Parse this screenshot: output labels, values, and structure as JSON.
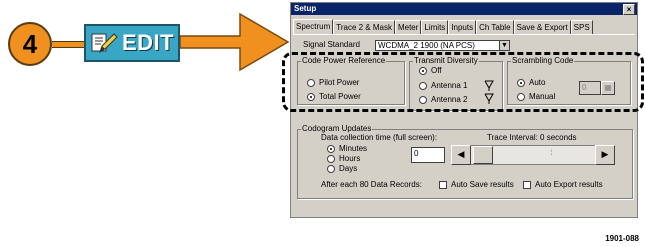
{
  "callout": {
    "step_number": "4",
    "button_label": "EDIT"
  },
  "dialog": {
    "title": "Setup",
    "close_glyph": "×",
    "tabs": [
      "Spectrum",
      "Trace 2 & Mask",
      "Meter",
      "Limits",
      "Inputs",
      "Ch Table",
      "Save & Export",
      "SPS"
    ],
    "signal_standard": {
      "label": "Signal Standard",
      "value": "WCDMA_2 1900 (NA PCS)"
    },
    "code_power_reference": {
      "title": "Code Power Reference",
      "options": [
        "Pilot Power",
        "Total Power"
      ],
      "selected": "Total Power"
    },
    "transmit_diversity": {
      "title": "Transmit Diversity",
      "options": [
        "Off",
        "Antenna 1",
        "Antenna 2"
      ],
      "selected": "Off"
    },
    "scrambling_code": {
      "title": "Scrambling Code",
      "options": [
        "Auto",
        "Manual"
      ],
      "selected": "Auto",
      "value": "0"
    },
    "codogram_updates": {
      "title": "Codogram Updates",
      "collection_label": "Data collection time (full screen):",
      "trace_interval": "Trace Interval: 0 seconds",
      "units": [
        "Minutes",
        "Hours",
        "Days"
      ],
      "selected_unit": "Minutes",
      "time_value": "0",
      "after_records_label": "After each 80 Data Records:",
      "auto_save_label": "Auto Save results",
      "auto_export_label": "Auto Export results"
    }
  },
  "figure_number": "1901-088",
  "colors": {
    "callout_orange": "#f0911f",
    "edit_button": "#3aa6c6",
    "titlebar": "#0a246a",
    "dialog_face": "#d4d0c8"
  }
}
